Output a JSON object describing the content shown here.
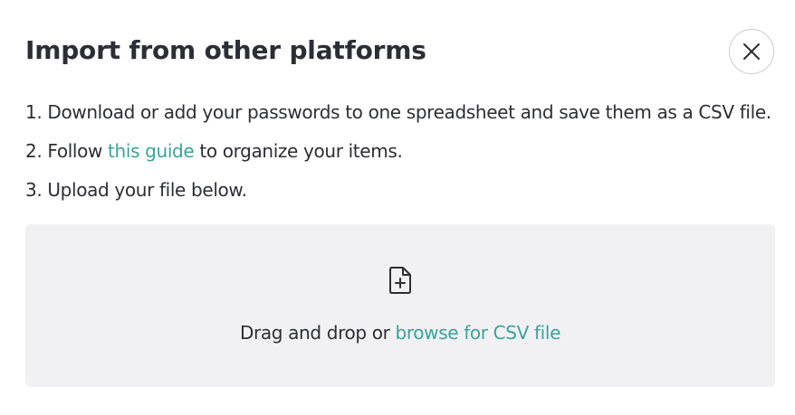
{
  "dialog": {
    "title": "Import from other platforms",
    "close_icon": "close-icon"
  },
  "steps": [
    {
      "text": "1. Download or add your passwords to one spreadsheet and save them as a CSV file."
    },
    {
      "before": "2. Follow ",
      "link": "this guide",
      "after": " to organize your items."
    },
    {
      "text": "3. Upload your file below."
    }
  ],
  "dropzone": {
    "icon": "file-plus-icon",
    "text": "Drag and drop or ",
    "link": "browse for CSV file"
  },
  "colors": {
    "text": "#2d2e35",
    "link": "#3aa39a",
    "dropzone_bg": "#f1f1f4",
    "close_border": "#c9cbd0"
  }
}
